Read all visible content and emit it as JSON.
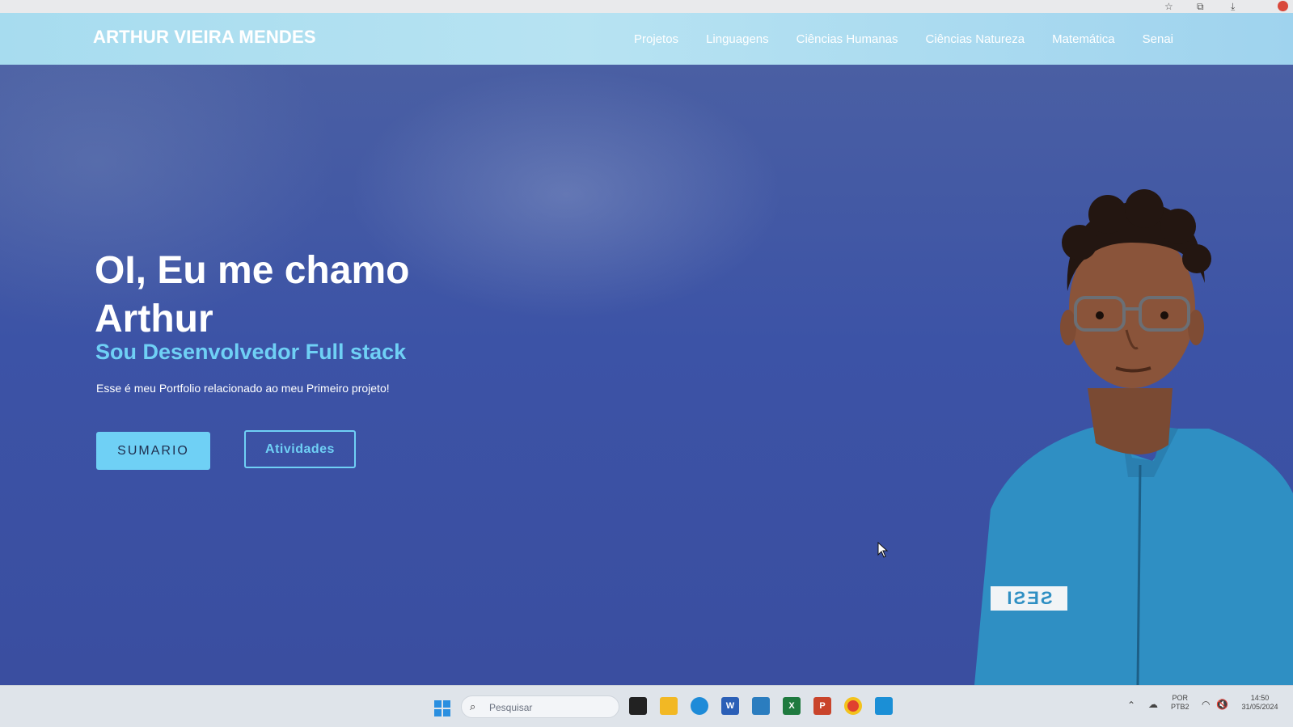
{
  "browser": {
    "icons": [
      "star-icon",
      "extensions-icon",
      "download-icon",
      "profile-icon"
    ]
  },
  "navbar": {
    "brand": "ARTHUR VIEIRA MENDES",
    "links": [
      "Projetos",
      "Linguagens",
      "Ciências Humanas",
      "Ciências Natureza",
      "Matemática",
      "Senai"
    ]
  },
  "hero": {
    "title": "OI, Eu me chamo Arthur",
    "subtitle": "Sou Desenvolvedor Full stack",
    "description": "Esse é meu Portfolio relacionado ao meu Primeiro projeto!",
    "primary_button": "SUMARIO",
    "secondary_button": "Atividades",
    "jacket_badge": "SESI"
  },
  "taskbar": {
    "search_placeholder": "Pesquisar",
    "apps": [
      "file-manager-icon",
      "folder-icon",
      "edge-icon",
      "word-icon",
      "store-icon",
      "excel-icon",
      "powerpoint-icon",
      "chrome-icon",
      "vscode-icon"
    ],
    "tray": {
      "language": "POR",
      "layout": "PTB2",
      "time": "14:50",
      "date": "31/05/2024"
    }
  },
  "colors": {
    "navbar": "#a7dcef",
    "hero_bg": "#3c53a6",
    "accent": "#6fd0f5",
    "text": "#ffffff"
  }
}
